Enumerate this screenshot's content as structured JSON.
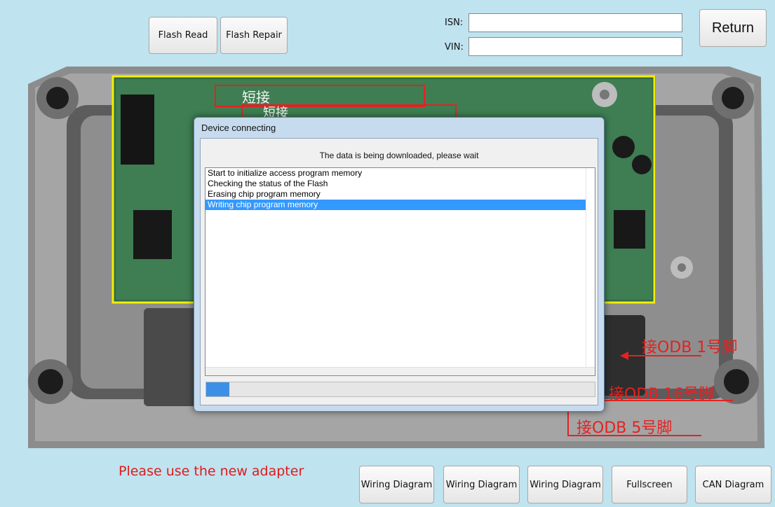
{
  "toolbar": {
    "flash_read": "Flash Read",
    "flash_repair": "Flash Repair",
    "return": "Return"
  },
  "fields": {
    "isn_label": "ISN:",
    "isn_value": "",
    "vin_label": "VIN:",
    "vin_value": ""
  },
  "board_labels": {
    "short1": "短接",
    "short2": "短接",
    "odb1": "接ODB 1号脚",
    "odb16": "接ODB 16号脚",
    "odb5": "接ODB 5号脚"
  },
  "dialog": {
    "title": "Device connecting",
    "message": "The data is being downloaded, please wait",
    "log": [
      "Start to initialize access program memory",
      "Checking the status of the Flash",
      "Erasing chip program memory",
      "Writing chip program memory"
    ],
    "selected_index": 3,
    "progress": 0.06
  },
  "note": "Please use the new adapter",
  "bottom_buttons": [
    "Wiring Diagram",
    "Wiring Diagram",
    "Wiring Diagram",
    "Fullscreen",
    "CAN Diagram"
  ],
  "colors": {
    "background": "#bfe3ef",
    "accent_red": "#e32222",
    "selection": "#3399ff",
    "frame_yellow": "#f5ee00"
  }
}
